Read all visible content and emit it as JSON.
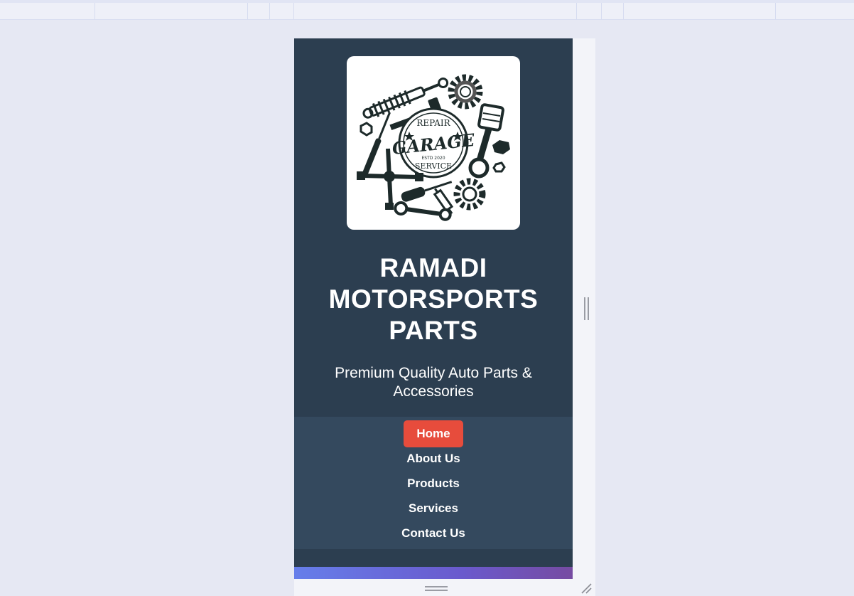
{
  "header": {
    "logo": {
      "badge_top": "REPAIR",
      "badge_main": "GARAGE",
      "badge_est": "ESTD 2020",
      "badge_bottom": "SERVICE"
    },
    "title_lines": [
      "RAMADI",
      "MOTORSPORTS",
      "PARTS"
    ],
    "tagline_lines": [
      "Premium Quality Auto Parts &",
      "Accessories"
    ]
  },
  "nav": {
    "items": [
      {
        "label": "Home",
        "active": true
      },
      {
        "label": "About Us",
        "active": false
      },
      {
        "label": "Products",
        "active": false
      },
      {
        "label": "Services",
        "active": false
      },
      {
        "label": "Contact Us",
        "active": false
      }
    ]
  },
  "colors": {
    "header_bg": "#2c3e50",
    "nav_bg": "#34495e",
    "active_nav": "#e74c3c",
    "hero_gradient_start": "#667eea",
    "hero_gradient_end": "#764ba2",
    "page_bg": "#e6e8f3"
  },
  "icons": {
    "logo": "garage-tools-logo",
    "resize": "resize-handle-icon",
    "scrollbar_grip": "grip-vertical-icon",
    "bottom_grip": "grip-horizontal-icon"
  }
}
